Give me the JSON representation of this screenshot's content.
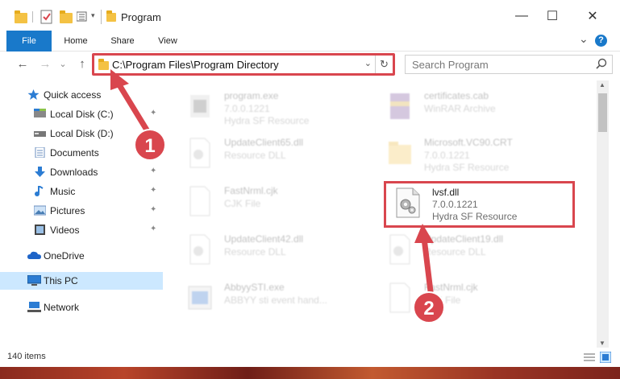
{
  "window": {
    "title": "Program",
    "minimize": "—",
    "maximize": "☐",
    "close": "✕"
  },
  "ribbon": {
    "tabs": [
      "File",
      "Home",
      "Share",
      "View"
    ],
    "expand": "⌄",
    "help": "?"
  },
  "address": {
    "path": "C:\\Program Files\\Program Directory",
    "search_placeholder": "Search Program"
  },
  "nav": {
    "back": "←",
    "forward": "→",
    "recent": "⌄",
    "up": "↑",
    "dropdown": "⌄",
    "refresh": "↻",
    "items": [
      {
        "label": "Quick access",
        "icon": "star-icon",
        "pinned": false
      },
      {
        "label": "Local Disk (C:)",
        "icon": "drive-icon",
        "pinned": true
      },
      {
        "label": "Local Disk (D:)",
        "icon": "drive-icon",
        "pinned": false
      },
      {
        "label": "Documents",
        "icon": "documents-icon",
        "pinned": true
      },
      {
        "label": "Downloads",
        "icon": "download-icon",
        "pinned": true
      },
      {
        "label": "Music",
        "icon": "music-icon",
        "pinned": true
      },
      {
        "label": "Pictures",
        "icon": "pictures-icon",
        "pinned": true
      },
      {
        "label": "Videos",
        "icon": "videos-icon",
        "pinned": true
      },
      {
        "label": "OneDrive",
        "icon": "cloud-icon",
        "pinned": false
      },
      {
        "label": "This PC",
        "icon": "computer-icon",
        "pinned": false
      },
      {
        "label": "Network",
        "icon": "network-icon",
        "pinned": false
      }
    ],
    "pin_glyph": "📌"
  },
  "files": [
    {
      "name": "program.exe",
      "line2": "7.0.0.1221",
      "line3": "Hydra SF Resource",
      "icon": "exe-icon"
    },
    {
      "name": "certificates.cab",
      "line2": "WinRAR Archive",
      "line3": "",
      "icon": "archive-icon"
    },
    {
      "name": "UpdateClient65.dll",
      "line2": "Resource DLL",
      "line3": "",
      "icon": "dll-gear-icon"
    },
    {
      "name": "Microsoft.VC90.CRT",
      "line2": "7.0.0.1221",
      "line3": "Hydra SF Resource",
      "icon": "folder-icon"
    },
    {
      "name": "FastNrml.cjk",
      "line2": "CJK File",
      "line3": "",
      "icon": "file-icon"
    },
    {
      "name": "lvsf.dll",
      "line2": "7.0.0.1221",
      "line3": "Hydra SF Resource",
      "icon": "dll-gear-icon"
    },
    {
      "name": "UpdateClient42.dll",
      "line2": "Resource DLL",
      "line3": "",
      "icon": "dll-gear-icon"
    },
    {
      "name": "UpdateClient19.dll",
      "line2": "Resource DLL",
      "line3": "",
      "icon": "dll-gear-icon"
    },
    {
      "name": "AbbyySTI.exe",
      "line2": "ABBYY sti event hand...",
      "line3": "",
      "icon": "app-icon"
    },
    {
      "name": "FastNrml.cjk",
      "line2": "CJK File",
      "line3": "",
      "icon": "file-icon"
    }
  ],
  "status": {
    "item_count": "140 items"
  },
  "annotations": {
    "step1": "1",
    "step2": "2"
  },
  "colors": {
    "accent": "#1979ca",
    "highlight": "#d9464e",
    "selected_nav": "#cce8ff"
  }
}
